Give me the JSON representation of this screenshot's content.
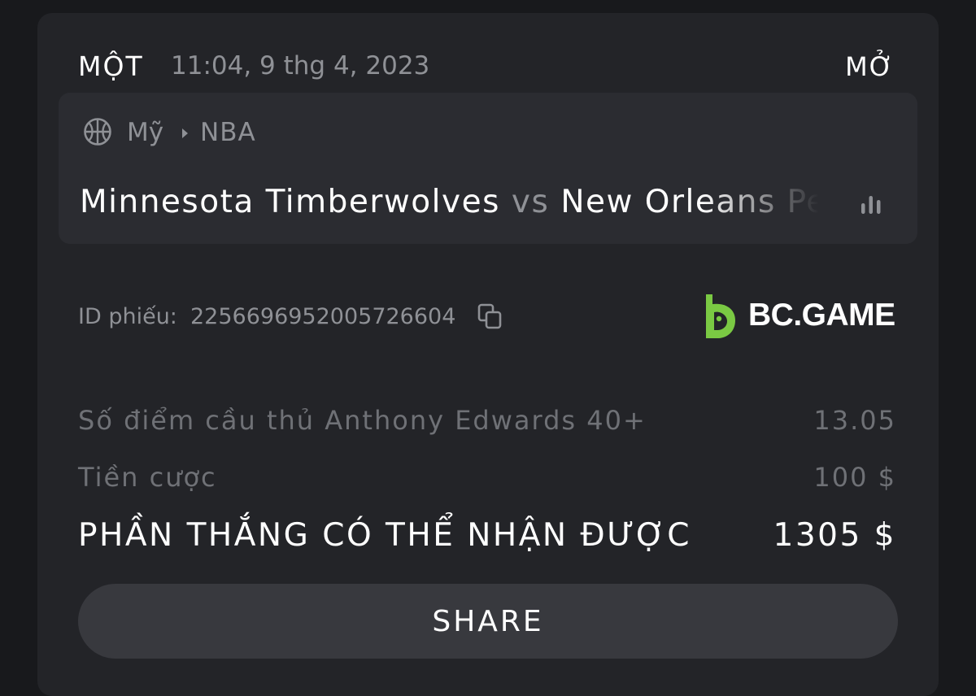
{
  "bet": {
    "type": "MỘT",
    "timestamp": "11:04, 9 thg 4, 2023",
    "status": "MỞ"
  },
  "event": {
    "sport_icon": "basketball-icon",
    "country": "Mỹ",
    "league": "NBA",
    "home_team": "Minnesota Timberwolves",
    "vs": "vs",
    "away_team": "New Orleans Pelicans",
    "stats_icon": "stats-bars-icon"
  },
  "ticket": {
    "label": "ID phiếu:",
    "id": "2256696952005726604",
    "copy_icon": "copy-icon"
  },
  "brand": {
    "name": "BC.GAME",
    "accent_color": "#7ac943"
  },
  "selection": {
    "label": "Số điểm cầu thủ Anthony Edwards 40+",
    "odds": "13.05"
  },
  "stake": {
    "label": "Tiền cược",
    "value": "100 $"
  },
  "payout": {
    "label": "PHẦN THẮNG CÓ THỂ NHẬN ĐƯỢC",
    "value": "1305 $"
  },
  "actions": {
    "share_label": "SHARE"
  }
}
